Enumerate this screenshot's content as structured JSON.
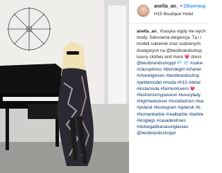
{
  "header": {
    "username": "anella_an_",
    "separator": "•",
    "follow_label": "Obserwuj",
    "location": "H15 Boutique Hotel"
  },
  "caption": {
    "username": "anella_an_",
    "lines": [
      "Klasyka nigdy nie wych",
      "mody. Seksowna elegancja. Tą i i",
      "modeli sukienek oraz cudownych",
      "dostępnych na @bestbrandsshop",
      "luxury clothes and more 💗 dress",
      "@bestbrandsshoppl 💎 💎 #sukie",
      "#classydress #blondegirl #chanel",
      "#chanelgloves #bestbrandsshop",
      "#petitemodel #moda #h15 #detal",
      "#instamoda #fashionlovers 💗",
      "#fashionismypassion #luxurylady",
      "#highheelslover #instafashion #wa",
      "#poland #bootsgram #gdansk #b",
      "#humanbarbie #realbarbie #barbie",
      "#longlegs #casadeishoes",
      "#dolcegabbanasunglasses",
      "@bestbrandsshoppl"
    ]
  },
  "colors": {
    "link": "#003569",
    "follow": "#3897f0",
    "text": "#262626"
  }
}
